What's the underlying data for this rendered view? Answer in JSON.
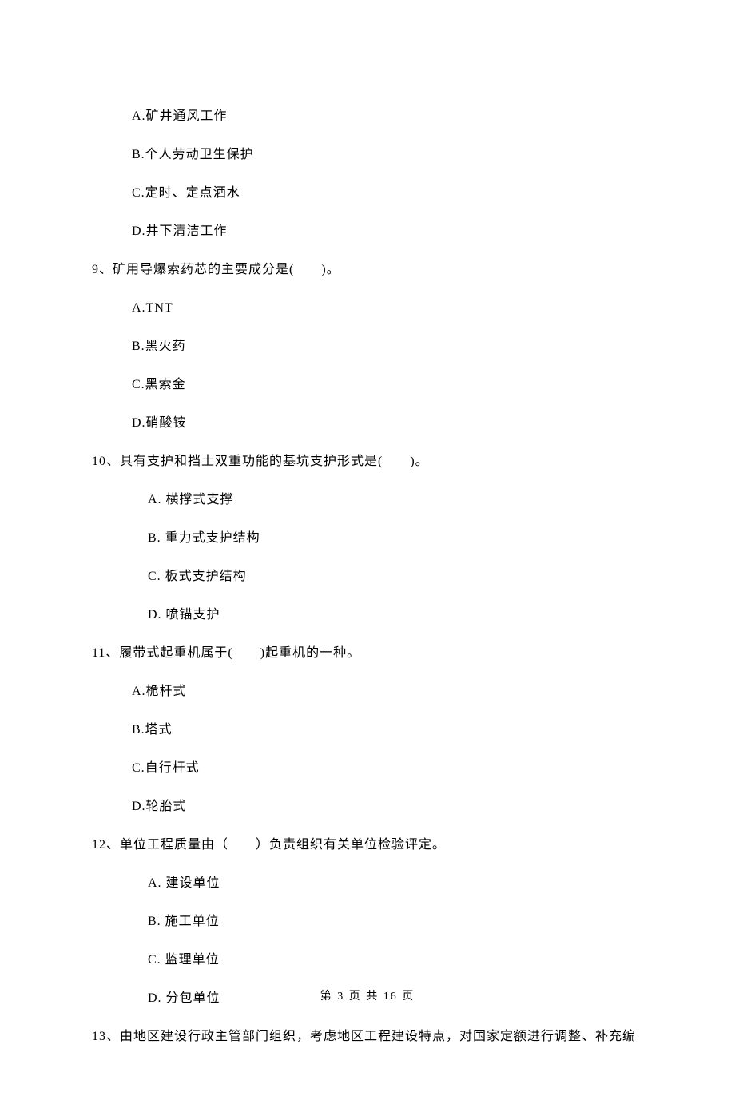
{
  "options_top": [
    "A.矿井通风工作",
    "B.个人劳动卫生保护",
    "C.定时、定点洒水",
    "D.井下清洁工作"
  ],
  "q9": {
    "text": "9、矿用导爆索药芯的主要成分是(　　)。",
    "options": [
      "A.TNT",
      "B.黑火药",
      "C.黑索金",
      "D.硝酸铵"
    ]
  },
  "q10": {
    "text": "10、具有支护和挡土双重功能的基坑支护形式是(　　)。",
    "options": [
      "A. 横撑式支撑",
      "B. 重力式支护结构",
      "C. 板式支护结构",
      "D. 喷锚支护"
    ]
  },
  "q11": {
    "text": "11、履带式起重机属于(　　)起重机的一种。",
    "options": [
      "A.桅杆式",
      "B.塔式",
      "C.自行杆式",
      "D.轮胎式"
    ]
  },
  "q12": {
    "text": "12、单位工程质量由（　　）负责组织有关单位检验评定。",
    "options": [
      "A. 建设单位",
      "B. 施工单位",
      "C. 监理单位",
      "D. 分包单位"
    ]
  },
  "q13": {
    "text": "13、由地区建设行政主管部门组织，考虑地区工程建设特点，对国家定额进行调整、补充编"
  },
  "footer": "第 3 页 共 16 页"
}
